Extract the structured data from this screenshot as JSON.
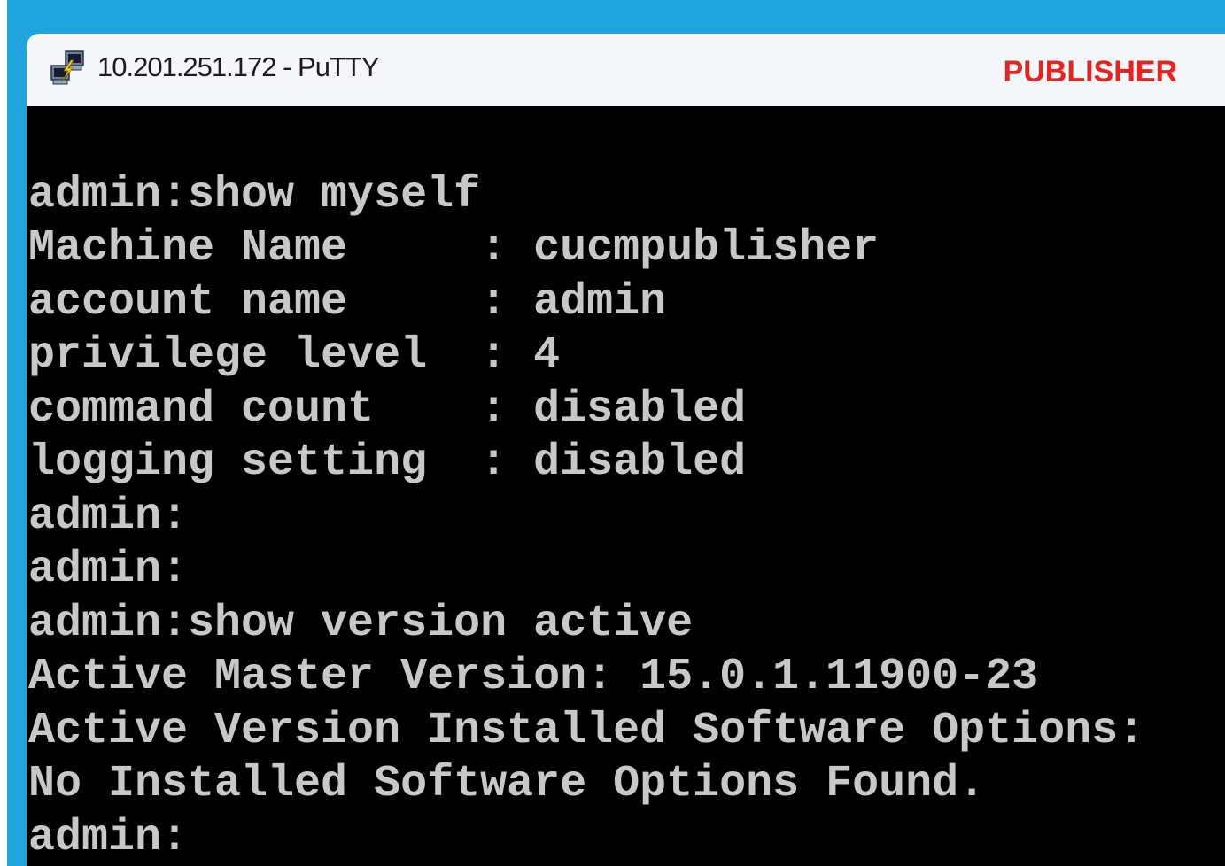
{
  "window": {
    "title": "10.201.251.172 - PuTTY",
    "server_label": "PUBLISHER"
  },
  "colors": {
    "backdrop": "#20a4de",
    "titlebar": "#f4f6fa",
    "terminal_bg": "#000000",
    "terminal_fg": "#c8c8c8",
    "server_label": "#e8231f"
  },
  "icons": {
    "app_icon": "putty-icon"
  },
  "terminal": {
    "lines": [
      "admin:show myself",
      "Machine Name     : cucmpublisher",
      "account name     : admin",
      "privilege level  : 4",
      "command count    : disabled",
      "logging setting  : disabled",
      "admin:",
      "admin:",
      "admin:show version active",
      "Active Master Version: 15.0.1.11900-23",
      "Active Version Installed Software Options:",
      "No Installed Software Options Found.",
      "admin:"
    ]
  }
}
